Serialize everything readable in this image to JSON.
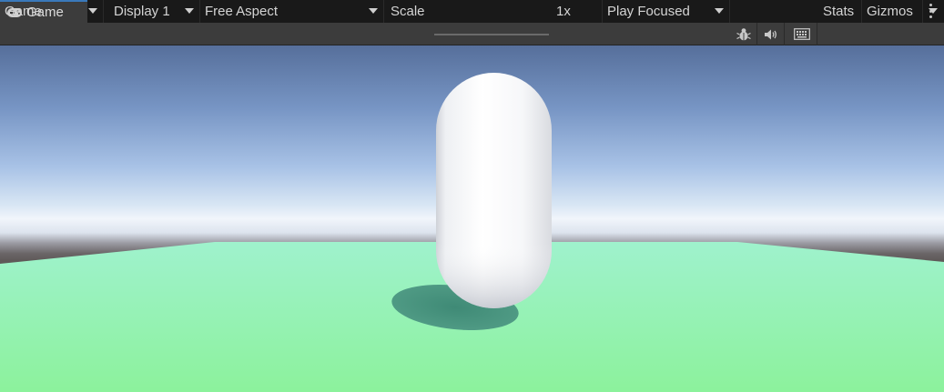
{
  "tab": {
    "label": "Game",
    "icon": "gamepad-icon"
  },
  "toolbar": {
    "view_mode": "Game",
    "display": "Display 1",
    "aspect": "Free Aspect",
    "scale_label": "Scale",
    "scale_value": "1x",
    "play_mode": "Play Focused",
    "stats_label": "Stats",
    "gizmos_label": "Gizmos",
    "icons": [
      "bug-icon",
      "audio-icon",
      "keyboard-icon"
    ]
  },
  "colors": {
    "ground_top": "#9ff2cd",
    "ground_bottom": "#8cf29c",
    "capsule": "#ffffff",
    "tab_accent": "#3a79bb"
  }
}
